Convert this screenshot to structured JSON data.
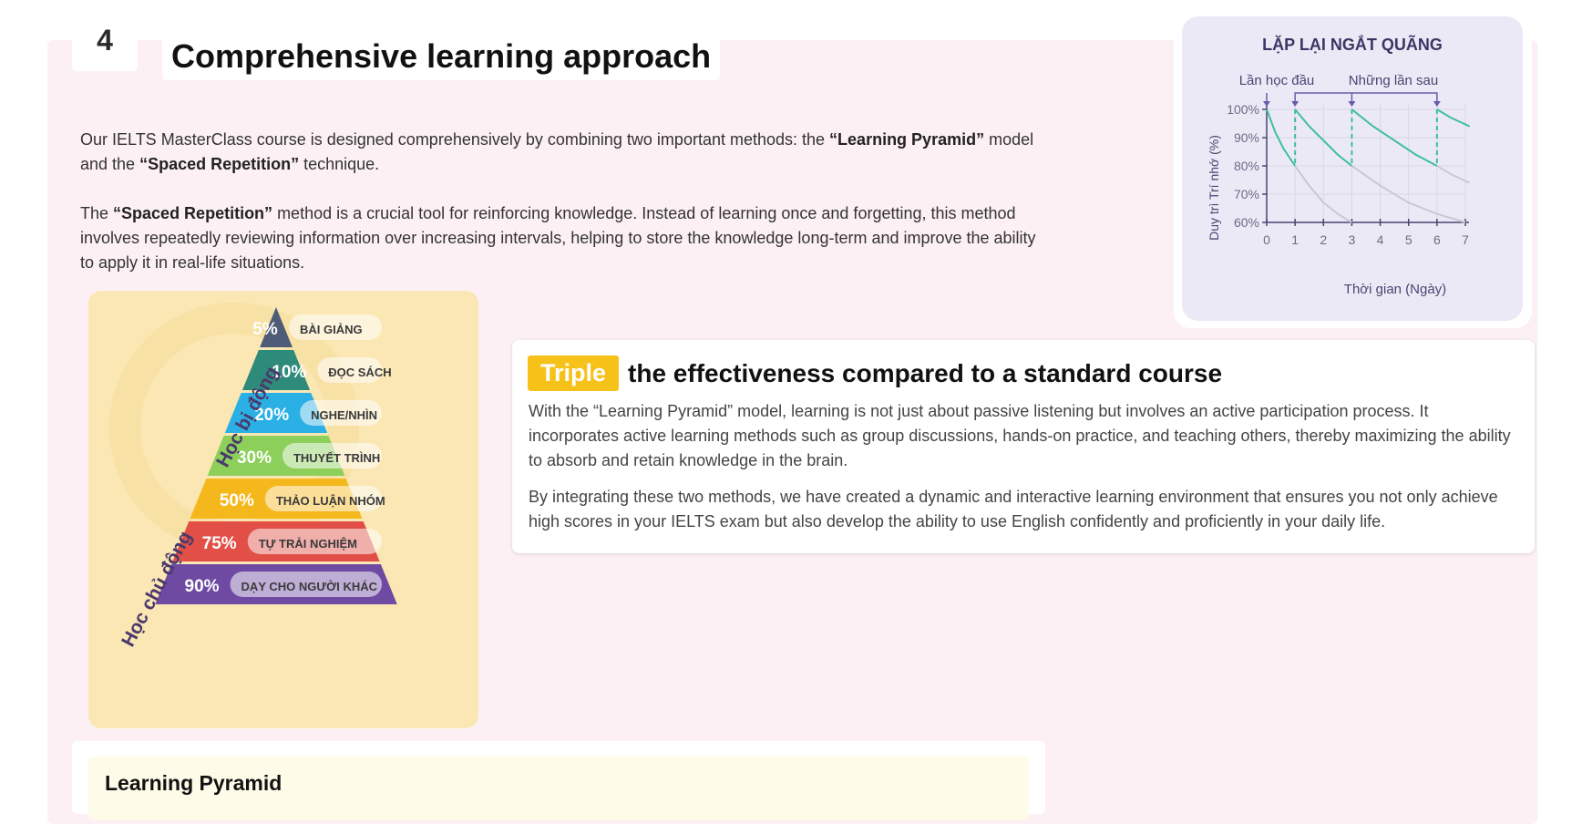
{
  "section": {
    "number": "4",
    "title": "Comprehensive learning approach"
  },
  "intro": {
    "p1_a": "Our IELTS MasterClass course is designed comprehensively by combining two important methods: the ",
    "p1_b": "“Learning Pyramid”",
    "p1_c": " model and the ",
    "p1_d": "“Spaced Repetition”",
    "p1_e": " technique.",
    "p2_a": "The ",
    "p2_b": "“Spaced Repetition”",
    "p2_c": " method is a crucial tool for reinforcing knowledge. Instead of learning once and forgetting, this method involves repeatedly reviewing information over increasing intervals, helping to store the knowledge long-term and improve the ability to apply it in real-life situations."
  },
  "pyramid": {
    "passive_label": "Học bị động",
    "active_label": "Học chủ động",
    "levels": [
      {
        "percent": "5%",
        "label": "BÀI GIẢNG",
        "color": "#4e5c78"
      },
      {
        "percent": "10%",
        "label": "ĐỌC SÁCH",
        "color": "#2e8a7a"
      },
      {
        "percent": "20%",
        "label": "NGHE/NHÌN",
        "color": "#2ab0e4"
      },
      {
        "percent": "30%",
        "label": "THUYẾT TRÌNH",
        "color": "#8ccf5a"
      },
      {
        "percent": "50%",
        "label": "THẢO LUẬN NHÓM",
        "color": "#f5b81c"
      },
      {
        "percent": "75%",
        "label": "TỰ TRẢI NGHIỆM",
        "color": "#e14f47"
      },
      {
        "percent": "90%",
        "label": "DẠY CHO NGƯỜI KHÁC",
        "color": "#6f4aa3"
      }
    ]
  },
  "chart_data": {
    "type": "line",
    "title": "LẶP LẠI NGẮT QUÃNG",
    "xlabel": "Thời gian (Ngày)",
    "ylabel": "Duy trì Trí nhớ (%)",
    "xlim": [
      0,
      7
    ],
    "ylim": [
      60,
      100
    ],
    "x_ticks": [
      "0",
      "1",
      "2",
      "3",
      "4",
      "5",
      "6",
      "7"
    ],
    "y_ticks": [
      "60%",
      "70%",
      "80%",
      "90%",
      "100%"
    ],
    "annotations": [
      "Lần học đầu",
      "Những lần sau"
    ],
    "review_days": [
      0,
      1,
      3,
      6
    ],
    "grid": true,
    "colors": {
      "retention": "#3dbf9a",
      "forgetting": "#c9c9cf",
      "accent": "#6b5aa8"
    },
    "series": [
      {
        "x": [
          0,
          0.3,
          0.6,
          1.0
        ],
        "y": [
          100,
          92,
          86,
          80
        ],
        "color": "#3dbf9a"
      },
      {
        "x": [
          1,
          1.5,
          2,
          2.5,
          3
        ],
        "y": [
          100,
          94,
          89,
          84,
          80
        ],
        "color": "#3dbf9a"
      },
      {
        "x": [
          3,
          3.75,
          4.5,
          5.25,
          6
        ],
        "y": [
          100,
          94,
          89,
          84,
          80
        ],
        "color": "#3dbf9a"
      },
      {
        "x": [
          6,
          6.5,
          7.15
        ],
        "y": [
          100,
          97,
          94
        ],
        "color": "#3dbf9a"
      },
      {
        "x": [
          1,
          1.5,
          2,
          2.5,
          3
        ],
        "y": [
          80,
          73,
          67,
          63,
          60
        ],
        "color": "#c9c9cf"
      },
      {
        "x": [
          3,
          4,
          5,
          6,
          7
        ],
        "y": [
          80,
          73,
          67,
          63,
          60
        ],
        "color": "#c9c9cf"
      },
      {
        "x": [
          6,
          6.5,
          7.15
        ],
        "y": [
          80,
          77,
          74
        ],
        "color": "#c9c9cf"
      }
    ]
  },
  "triple": {
    "badge": "Triple",
    "title": "the effectiveness compared to a standard course",
    "p1": "With the “Learning Pyramid” model, learning is not just about passive listening but involves an active participation process. It incorporates active learning methods such as group discussions, hands-on practice, and teaching others, thereby maximizing the ability to absorb and retain knowledge in the brain.",
    "p2": "By integrating these two methods, we have created a dynamic and interactive learning environment that ensures you not only achieve high scores in your IELTS exam but also develop the ability to use English confidently and proficiently in your daily life."
  },
  "learning_pyramid_section": {
    "title": "Learning Pyramid"
  }
}
